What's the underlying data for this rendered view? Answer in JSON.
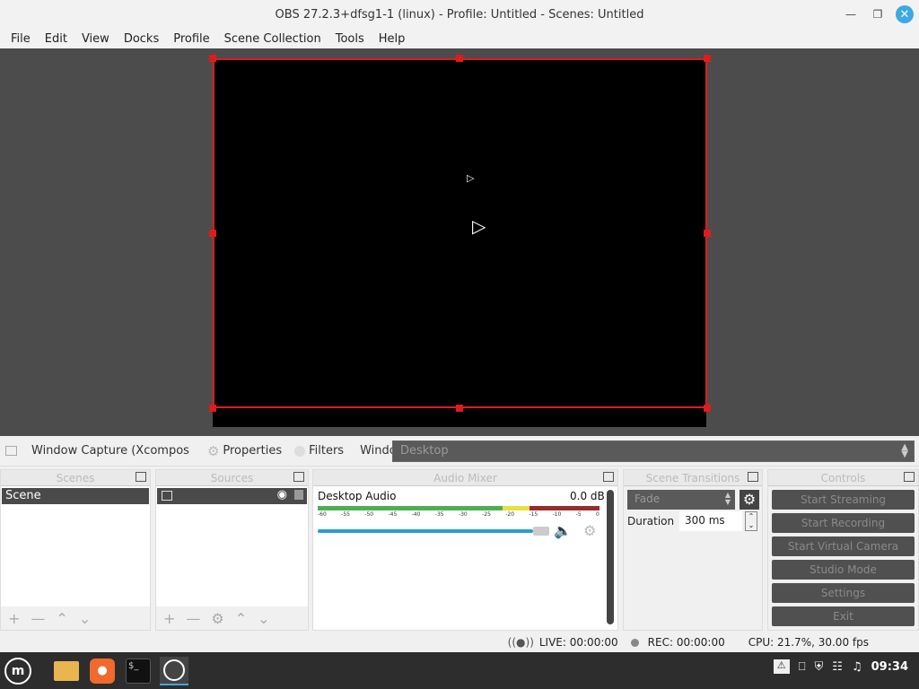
{
  "window": {
    "title": "OBS 27.2.3+dfsg1-1 (linux) - Profile: Untitled - Scenes: Untitled"
  },
  "menu": [
    "File",
    "Edit",
    "View",
    "Docks",
    "Profile",
    "Scene Collection",
    "Tools",
    "Help"
  ],
  "source_toolbar": {
    "source_name": "Window Capture (Xcompos",
    "properties": "Properties",
    "filters": "Filters",
    "window_label": "Window",
    "window_value": "Desktop"
  },
  "docks": {
    "scenes": {
      "title": "Scenes",
      "items": [
        "Scene"
      ]
    },
    "sources": {
      "title": "Sources"
    },
    "mixer": {
      "title": "Audio Mixer",
      "channel": "Desktop Audio",
      "db": "0.0 dB",
      "scale": [
        "-60",
        "-55",
        "-50",
        "-45",
        "-40",
        "-35",
        "-30",
        "-25",
        "-20",
        "-15",
        "-10",
        "-5",
        "0"
      ],
      "volume": 0.8
    },
    "transitions": {
      "title": "Scene Transitions",
      "selected": "Fade",
      "duration_label": "Duration",
      "duration_value": "300 ms"
    },
    "controls": {
      "title": "Controls",
      "buttons": [
        "Start Streaming",
        "Start Recording",
        "Start Virtual Camera",
        "Studio Mode",
        "Settings",
        "Exit"
      ]
    }
  },
  "status": {
    "live": "LIVE: 00:00:00",
    "rec": "REC: 00:00:00",
    "cpu": "CPU: 21.7%, 30.00 fps"
  },
  "taskbar": {
    "time": "09:34"
  }
}
